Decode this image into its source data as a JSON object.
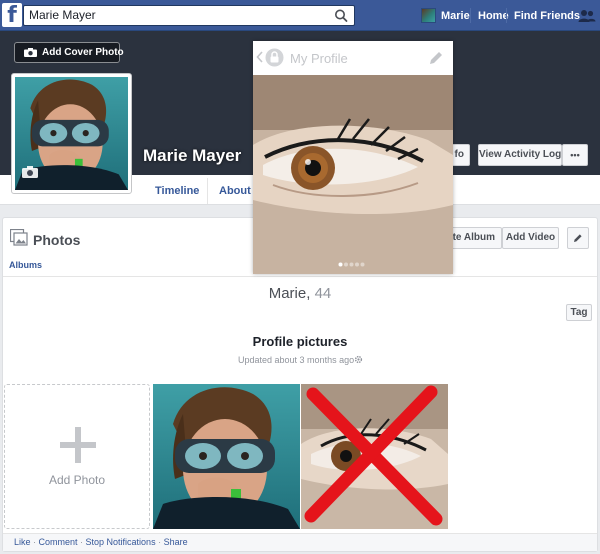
{
  "topbar": {
    "search_value": "Marie Mayer",
    "user_name": "Marie",
    "home_label": "Home",
    "find_friends_label": "Find Friends"
  },
  "cover": {
    "add_cover_label": "Add Cover Photo"
  },
  "profile": {
    "name": "Marie Mayer"
  },
  "tabs": [
    "Timeline",
    "About"
  ],
  "actions": {
    "info_fragment": "fo",
    "activity_log_label": "View Activity Log",
    "more_label": "•••"
  },
  "photos": {
    "title": "Photos",
    "albums_label": "Albums",
    "create_album_fragment": "eate Album",
    "add_video_label": "Add Video",
    "tag_label": "Tag",
    "caption_name": "Marie,",
    "caption_age": "44",
    "album_title": "Profile pictures",
    "album_updated": "Updated about 3 months ago",
    "add_photo_label": "Add Photo"
  },
  "footer": {
    "like": "Like",
    "comment": "Comment",
    "stop_notifications": "Stop Notifications",
    "share": "Share",
    "sep": " · "
  },
  "overlay": {
    "title": "My Profile",
    "dots_count": 5,
    "active_dot": 0
  },
  "colors": {
    "brand_blue": "#3b5998",
    "link_blue": "#365899",
    "cover_dark": "#2b323e",
    "cross_red": "#e5141b"
  },
  "icons": [
    "facebook-logo-icon",
    "search-icon",
    "friends-icon",
    "camera-icon",
    "photos-icon",
    "gear-icon",
    "plus-icon",
    "pencil-icon",
    "lock-icon",
    "back-chevron-icon"
  ]
}
